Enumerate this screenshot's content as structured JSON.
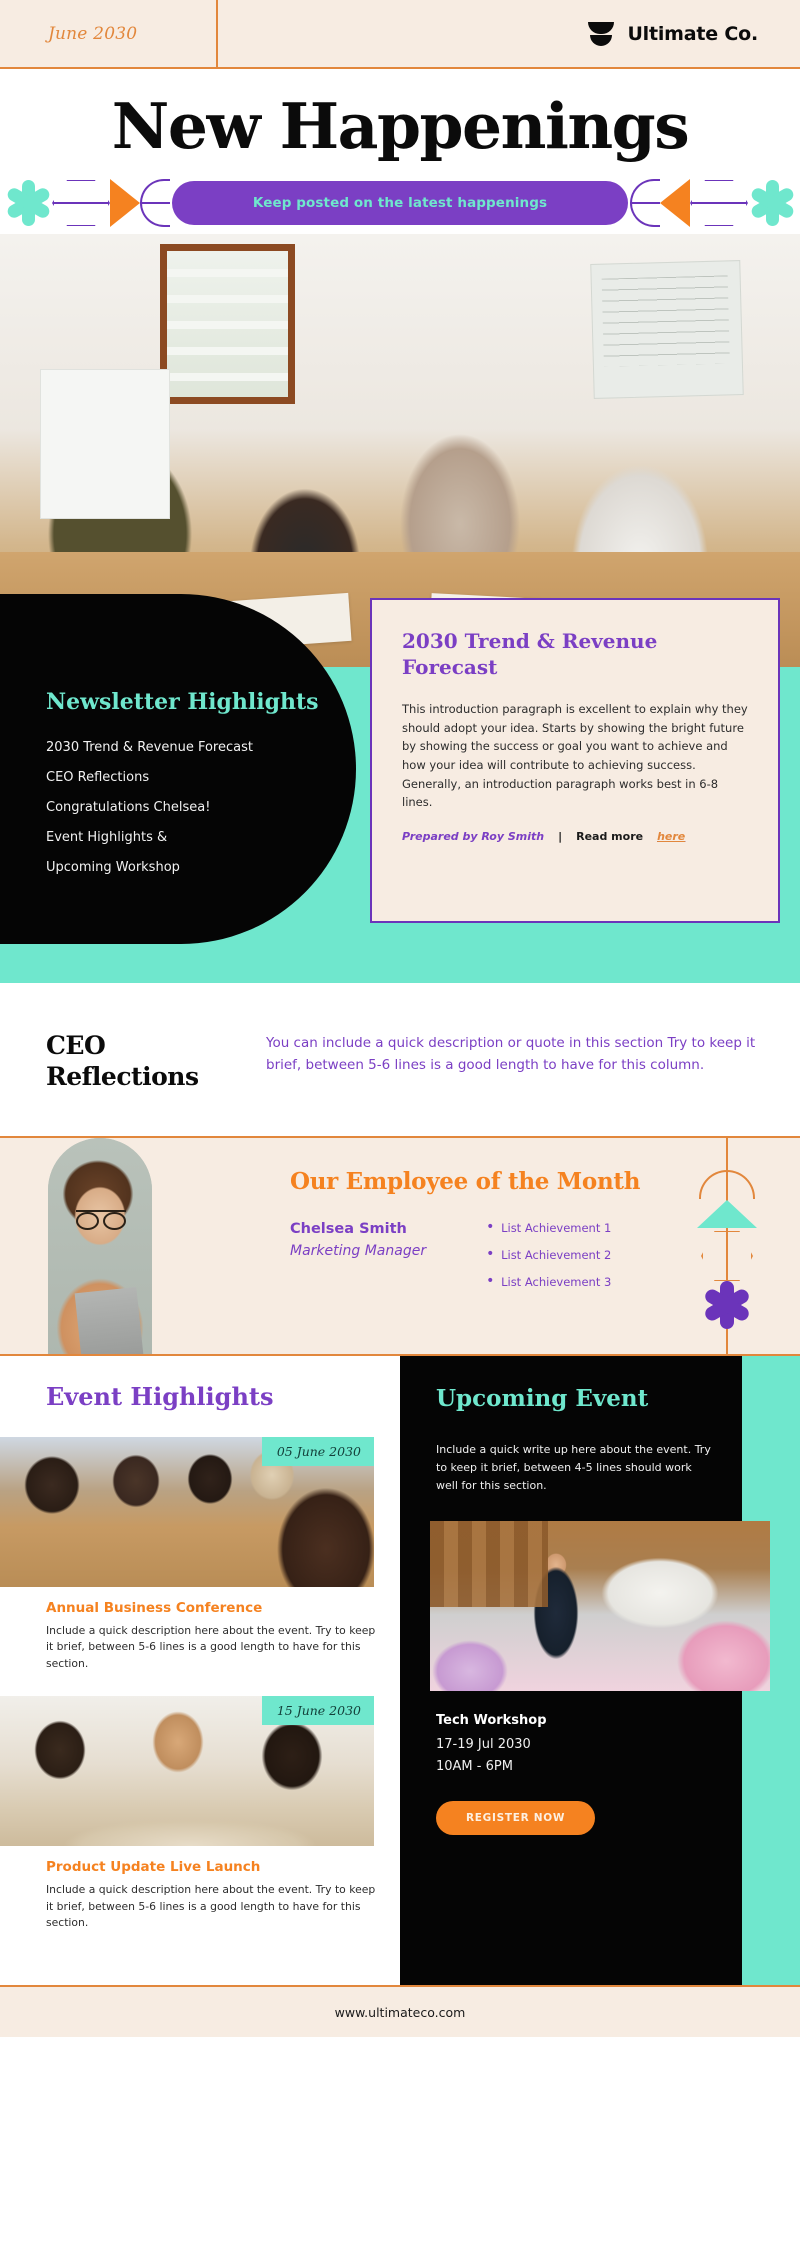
{
  "header": {
    "issue_date": "June 2030",
    "brand_name": "Ultimate Co.",
    "logo_icon": "stacked-bowls-logo-icon"
  },
  "masthead": {
    "title": "New Happenings"
  },
  "banner": {
    "text": "Keep posted on the latest happenings",
    "pill_color": "#7b3fc4",
    "text_color": "#6fe7cd",
    "decor": [
      "asterisk-teal",
      "hexagon-purple",
      "triangle-orange",
      "half-circle-purple"
    ]
  },
  "highlights": {
    "title": "Newsletter Highlights",
    "items": [
      "2030 Trend & Revenue Forecast",
      "CEO Reflections",
      "Congratulations Chelsea!",
      "Event Highlights &",
      "Upcoming Workshop"
    ]
  },
  "trend_card": {
    "title": "2030 Trend & Revenue Forecast",
    "body": "This introduction paragraph is excellent to explain why they should adopt your idea. Starts by showing the bright future by showing the success or goal you want to achieve and how your idea will contribute to achieving success. Generally, an introduction paragraph works best in 6-8 lines.",
    "author": "Prepared by Roy Smith",
    "separator": "|",
    "read_more_label": "Read more",
    "read_more_link": "here"
  },
  "ceo": {
    "title": "CEO Reflections",
    "body": "You can include a quick description or quote in this section Try to keep it brief, between 5-6 lines is a good length to have for this column."
  },
  "employee": {
    "title": "Our Employee of the Month",
    "name": "Chelsea Smith",
    "role": "Marketing Manager",
    "achievements": [
      "List Achievement 1",
      "List Achievement 2",
      "List Achievement 3"
    ]
  },
  "events": {
    "title": "Event Highlights",
    "cards": [
      {
        "date": "05 June 2030",
        "title": "Annual Business Conference",
        "description": "Include a quick description here about the event. Try to keep it brief, between 5-6 lines is a good length to have for this section."
      },
      {
        "date": "15 June 2030",
        "title": "Product Update Live Launch",
        "description": "Include a quick description here about the event. Try to keep it brief, between 5-6 lines is a good length to have for this section."
      }
    ]
  },
  "upcoming": {
    "title": "Upcoming Event",
    "blurb": "Include a quick write up here about the event. Try to keep it brief, between 4-5 lines should work well for this section.",
    "workshop_title": "Tech Workshop",
    "workshop_dates": "17-19 Jul 2030",
    "workshop_time": "10AM - 6PM",
    "cta_label": "REGISTER NOW"
  },
  "footer": {
    "website": "www.ultimateco.com"
  },
  "colors": {
    "cream": "#f7ece2",
    "orange": "#e2873c",
    "orange_bright": "#f58220",
    "purple": "#7b3fc4",
    "purple_deep": "#6b34ba",
    "teal": "#6fe7cd",
    "black": "#050505"
  }
}
